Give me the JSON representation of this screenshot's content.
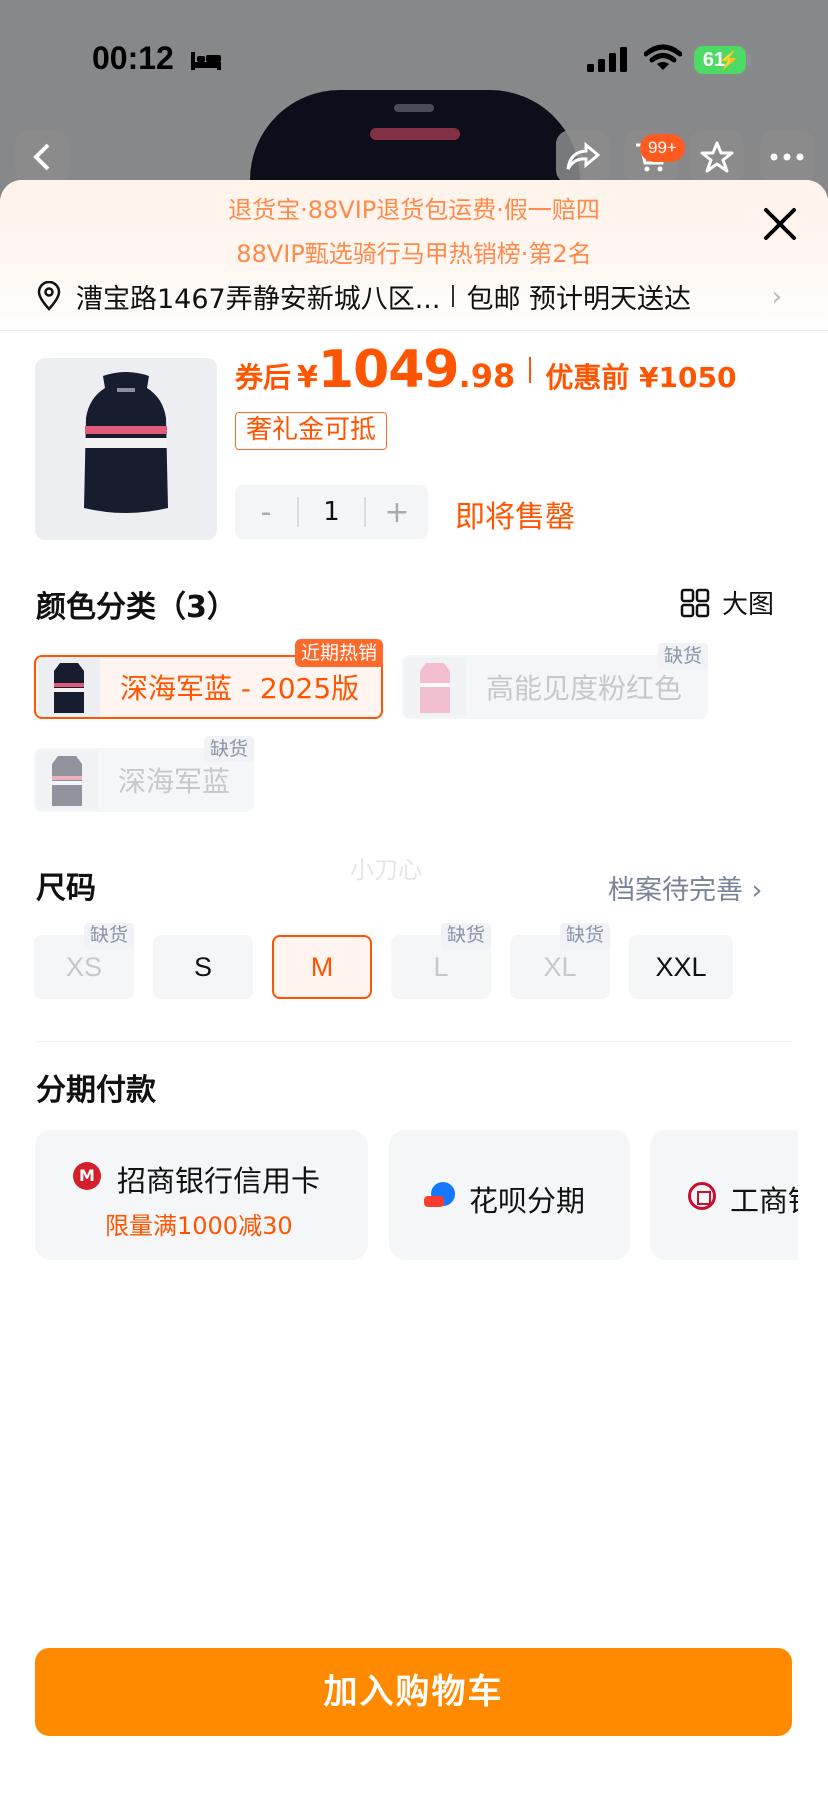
{
  "status_bar": {
    "time": "00:12",
    "battery": "61"
  },
  "nav": {
    "cart_badge": "99+"
  },
  "sheet": {
    "promo_line_1": "退货宝·88VIP退货包运费·假一赔四",
    "promo_line_2": "88VIP甄选骑行马甲热销榜·第2名",
    "address": "漕宝路1467弄静安新城八区...",
    "shipping": "包邮 预计明天送达",
    "price": {
      "label": "券后",
      "currency": "¥",
      "integer": "1049",
      "decimal": ".98",
      "before_label": "优惠前 ¥1050"
    },
    "coupon_tag": "奢礼金可抵",
    "quantity": {
      "minus": "-",
      "value": "1",
      "plus": "+"
    },
    "stock_note": "即将售罄",
    "color_section": {
      "title": "颜色分类（3）",
      "big_image_label": "大图",
      "options": [
        {
          "label": "深海军蓝 - 2025版",
          "state": "selected",
          "badge": "近期热销"
        },
        {
          "label": "高能见度粉红色",
          "state": "unavailable",
          "badge": "缺货"
        },
        {
          "label": "深海军蓝",
          "state": "unavailable",
          "badge": "缺货"
        }
      ]
    },
    "watermark": "小刀心",
    "size_section": {
      "title": "尺码",
      "profile_link": "档案待完善",
      "sizes": [
        {
          "label": "XS",
          "state": "unavailable",
          "badge": "缺货"
        },
        {
          "label": "S",
          "state": "available",
          "badge": ""
        },
        {
          "label": "M",
          "state": "selected",
          "badge": ""
        },
        {
          "label": "L",
          "state": "unavailable",
          "badge": "缺货"
        },
        {
          "label": "XL",
          "state": "unavailable",
          "badge": "缺货"
        },
        {
          "label": "XXL",
          "state": "available",
          "badge": ""
        }
      ]
    },
    "installment_section": {
      "title": "分期付款",
      "options": [
        {
          "name": "招商银行信用卡",
          "sub": "限量满1000减30"
        },
        {
          "name": "花呗分期",
          "sub": ""
        },
        {
          "name": "工商银行",
          "sub": ""
        }
      ]
    },
    "cta": "加入购物车"
  },
  "colors": {
    "accent": "#ff5500",
    "cta": "#ff8a00",
    "promo": "#ff8a4a"
  }
}
